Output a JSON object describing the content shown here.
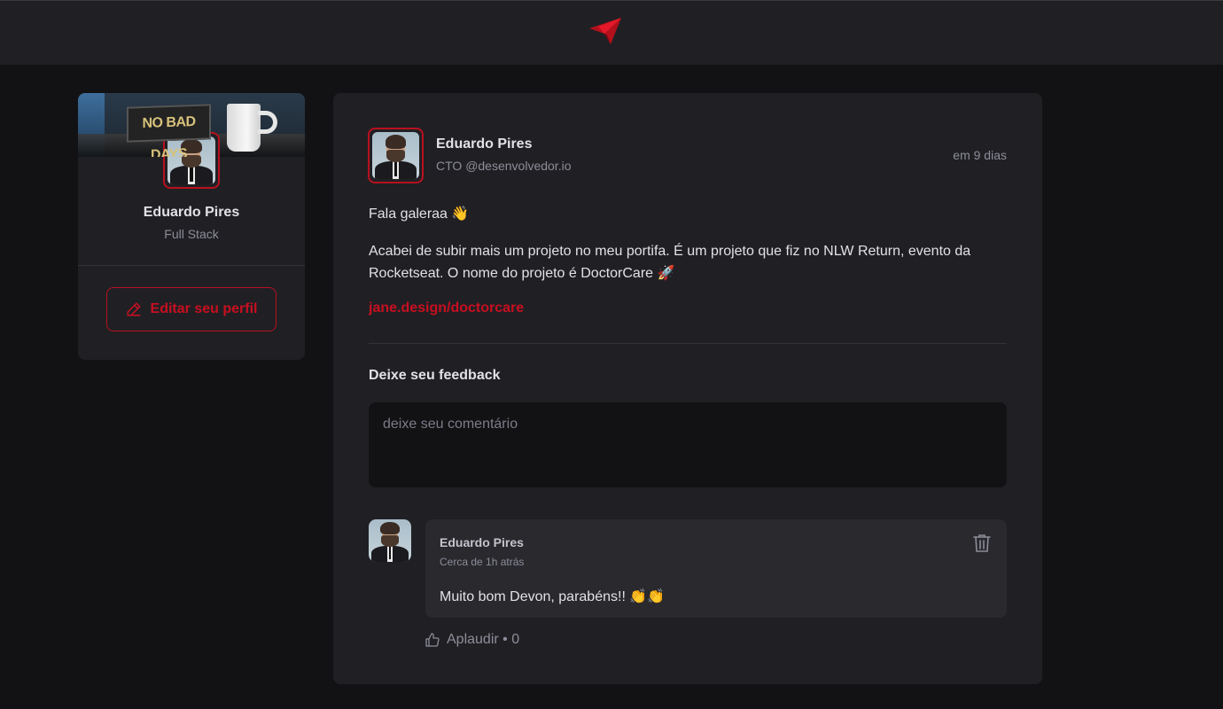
{
  "sidebar": {
    "cover_sign_text": "NO BAD DAYS",
    "name": "Eduardo Pires",
    "role": "Full Stack",
    "edit_button": "Editar seu perfil"
  },
  "post": {
    "author_name": "Eduardo Pires",
    "author_role": "CTO @desenvolvedor.io",
    "time": "em 9 dias",
    "paragraph_1": "Fala galeraa 👋",
    "paragraph_2": "Acabei de subir mais um projeto no meu portifa. É um projeto que fiz no NLW Return, evento da Rocketseat. O nome do projeto é DoctorCare 🚀",
    "link": "jane.design/doctorcare",
    "feedback_title": "Deixe seu feedback",
    "comment_placeholder": "deixe seu comentário"
  },
  "comment": {
    "author_name": "Eduardo Pires",
    "time": "Cerca de 1h atrás",
    "text": "Muito bom Devon, parabéns!! 👏👏",
    "applaud_label": "Aplaudir",
    "applaud_separator": " • ",
    "applaud_count": "0"
  },
  "colors": {
    "accent": "#c80f20",
    "background": "#121214",
    "surface": "#202024",
    "comment_surface": "#29292e"
  },
  "icons": {
    "logo": "paper-plane-logo-icon",
    "edit": "pencil-icon",
    "delete": "trash-icon",
    "applaud": "thumbs-up-icon"
  }
}
